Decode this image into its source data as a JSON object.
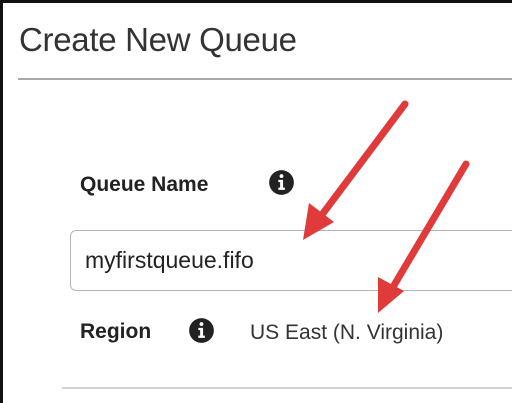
{
  "page": {
    "title": "Create New Queue"
  },
  "form": {
    "queue_name": {
      "label": "Queue Name",
      "value": "myfirstqueue.fifo",
      "info_icon": "info-icon"
    },
    "region": {
      "label": "Region",
      "value": "US East (N. Virginia)",
      "info_icon": "info-icon"
    }
  },
  "colors": {
    "title_text": "#333333",
    "label_text": "#222222",
    "input_border": "#b5b5b5",
    "annotation_arrow": "#e03a3a"
  },
  "annotations": {
    "arrows": [
      "red-arrow-to-queue-name",
      "red-arrow-to-region"
    ]
  }
}
